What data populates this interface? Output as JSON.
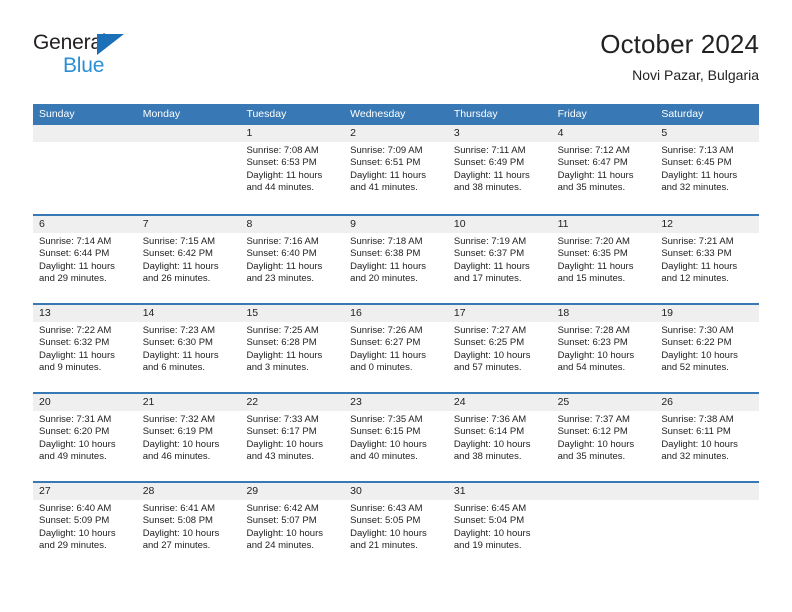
{
  "brand": {
    "line1": "General",
    "line2": "Blue",
    "triangle_color": "#1c70b8",
    "text_color": "#231f20",
    "blue_text_color": "#2b8fd6"
  },
  "header": {
    "title": "October 2024",
    "subtitle": "Novi Pazar, Bulgaria"
  },
  "theme": {
    "header_bar": "#3878b4",
    "daynum_band": "#efefef",
    "text": "#222222",
    "page_bg": "#ffffff"
  },
  "weekdays": [
    "Sunday",
    "Monday",
    "Tuesday",
    "Wednesday",
    "Thursday",
    "Friday",
    "Saturday"
  ],
  "weeks": [
    [
      {
        "day": "",
        "sunrise": "",
        "sunset": "",
        "daylight1": "",
        "daylight2": ""
      },
      {
        "day": "",
        "sunrise": "",
        "sunset": "",
        "daylight1": "",
        "daylight2": ""
      },
      {
        "day": "1",
        "sunrise": "Sunrise: 7:08 AM",
        "sunset": "Sunset: 6:53 PM",
        "daylight1": "Daylight: 11 hours",
        "daylight2": "and 44 minutes."
      },
      {
        "day": "2",
        "sunrise": "Sunrise: 7:09 AM",
        "sunset": "Sunset: 6:51 PM",
        "daylight1": "Daylight: 11 hours",
        "daylight2": "and 41 minutes."
      },
      {
        "day": "3",
        "sunrise": "Sunrise: 7:11 AM",
        "sunset": "Sunset: 6:49 PM",
        "daylight1": "Daylight: 11 hours",
        "daylight2": "and 38 minutes."
      },
      {
        "day": "4",
        "sunrise": "Sunrise: 7:12 AM",
        "sunset": "Sunset: 6:47 PM",
        "daylight1": "Daylight: 11 hours",
        "daylight2": "and 35 minutes."
      },
      {
        "day": "5",
        "sunrise": "Sunrise: 7:13 AM",
        "sunset": "Sunset: 6:45 PM",
        "daylight1": "Daylight: 11 hours",
        "daylight2": "and 32 minutes."
      }
    ],
    [
      {
        "day": "6",
        "sunrise": "Sunrise: 7:14 AM",
        "sunset": "Sunset: 6:44 PM",
        "daylight1": "Daylight: 11 hours",
        "daylight2": "and 29 minutes."
      },
      {
        "day": "7",
        "sunrise": "Sunrise: 7:15 AM",
        "sunset": "Sunset: 6:42 PM",
        "daylight1": "Daylight: 11 hours",
        "daylight2": "and 26 minutes."
      },
      {
        "day": "8",
        "sunrise": "Sunrise: 7:16 AM",
        "sunset": "Sunset: 6:40 PM",
        "daylight1": "Daylight: 11 hours",
        "daylight2": "and 23 minutes."
      },
      {
        "day": "9",
        "sunrise": "Sunrise: 7:18 AM",
        "sunset": "Sunset: 6:38 PM",
        "daylight1": "Daylight: 11 hours",
        "daylight2": "and 20 minutes."
      },
      {
        "day": "10",
        "sunrise": "Sunrise: 7:19 AM",
        "sunset": "Sunset: 6:37 PM",
        "daylight1": "Daylight: 11 hours",
        "daylight2": "and 17 minutes."
      },
      {
        "day": "11",
        "sunrise": "Sunrise: 7:20 AM",
        "sunset": "Sunset: 6:35 PM",
        "daylight1": "Daylight: 11 hours",
        "daylight2": "and 15 minutes."
      },
      {
        "day": "12",
        "sunrise": "Sunrise: 7:21 AM",
        "sunset": "Sunset: 6:33 PM",
        "daylight1": "Daylight: 11 hours",
        "daylight2": "and 12 minutes."
      }
    ],
    [
      {
        "day": "13",
        "sunrise": "Sunrise: 7:22 AM",
        "sunset": "Sunset: 6:32 PM",
        "daylight1": "Daylight: 11 hours",
        "daylight2": "and 9 minutes."
      },
      {
        "day": "14",
        "sunrise": "Sunrise: 7:23 AM",
        "sunset": "Sunset: 6:30 PM",
        "daylight1": "Daylight: 11 hours",
        "daylight2": "and 6 minutes."
      },
      {
        "day": "15",
        "sunrise": "Sunrise: 7:25 AM",
        "sunset": "Sunset: 6:28 PM",
        "daylight1": "Daylight: 11 hours",
        "daylight2": "and 3 minutes."
      },
      {
        "day": "16",
        "sunrise": "Sunrise: 7:26 AM",
        "sunset": "Sunset: 6:27 PM",
        "daylight1": "Daylight: 11 hours",
        "daylight2": "and 0 minutes."
      },
      {
        "day": "17",
        "sunrise": "Sunrise: 7:27 AM",
        "sunset": "Sunset: 6:25 PM",
        "daylight1": "Daylight: 10 hours",
        "daylight2": "and 57 minutes."
      },
      {
        "day": "18",
        "sunrise": "Sunrise: 7:28 AM",
        "sunset": "Sunset: 6:23 PM",
        "daylight1": "Daylight: 10 hours",
        "daylight2": "and 54 minutes."
      },
      {
        "day": "19",
        "sunrise": "Sunrise: 7:30 AM",
        "sunset": "Sunset: 6:22 PM",
        "daylight1": "Daylight: 10 hours",
        "daylight2": "and 52 minutes."
      }
    ],
    [
      {
        "day": "20",
        "sunrise": "Sunrise: 7:31 AM",
        "sunset": "Sunset: 6:20 PM",
        "daylight1": "Daylight: 10 hours",
        "daylight2": "and 49 minutes."
      },
      {
        "day": "21",
        "sunrise": "Sunrise: 7:32 AM",
        "sunset": "Sunset: 6:19 PM",
        "daylight1": "Daylight: 10 hours",
        "daylight2": "and 46 minutes."
      },
      {
        "day": "22",
        "sunrise": "Sunrise: 7:33 AM",
        "sunset": "Sunset: 6:17 PM",
        "daylight1": "Daylight: 10 hours",
        "daylight2": "and 43 minutes."
      },
      {
        "day": "23",
        "sunrise": "Sunrise: 7:35 AM",
        "sunset": "Sunset: 6:15 PM",
        "daylight1": "Daylight: 10 hours",
        "daylight2": "and 40 minutes."
      },
      {
        "day": "24",
        "sunrise": "Sunrise: 7:36 AM",
        "sunset": "Sunset: 6:14 PM",
        "daylight1": "Daylight: 10 hours",
        "daylight2": "and 38 minutes."
      },
      {
        "day": "25",
        "sunrise": "Sunrise: 7:37 AM",
        "sunset": "Sunset: 6:12 PM",
        "daylight1": "Daylight: 10 hours",
        "daylight2": "and 35 minutes."
      },
      {
        "day": "26",
        "sunrise": "Sunrise: 7:38 AM",
        "sunset": "Sunset: 6:11 PM",
        "daylight1": "Daylight: 10 hours",
        "daylight2": "and 32 minutes."
      }
    ],
    [
      {
        "day": "27",
        "sunrise": "Sunrise: 6:40 AM",
        "sunset": "Sunset: 5:09 PM",
        "daylight1": "Daylight: 10 hours",
        "daylight2": "and 29 minutes."
      },
      {
        "day": "28",
        "sunrise": "Sunrise: 6:41 AM",
        "sunset": "Sunset: 5:08 PM",
        "daylight1": "Daylight: 10 hours",
        "daylight2": "and 27 minutes."
      },
      {
        "day": "29",
        "sunrise": "Sunrise: 6:42 AM",
        "sunset": "Sunset: 5:07 PM",
        "daylight1": "Daylight: 10 hours",
        "daylight2": "and 24 minutes."
      },
      {
        "day": "30",
        "sunrise": "Sunrise: 6:43 AM",
        "sunset": "Sunset: 5:05 PM",
        "daylight1": "Daylight: 10 hours",
        "daylight2": "and 21 minutes."
      },
      {
        "day": "31",
        "sunrise": "Sunrise: 6:45 AM",
        "sunset": "Sunset: 5:04 PM",
        "daylight1": "Daylight: 10 hours",
        "daylight2": "and 19 minutes."
      },
      {
        "day": "",
        "sunrise": "",
        "sunset": "",
        "daylight1": "",
        "daylight2": ""
      },
      {
        "day": "",
        "sunrise": "",
        "sunset": "",
        "daylight1": "",
        "daylight2": ""
      }
    ]
  ]
}
